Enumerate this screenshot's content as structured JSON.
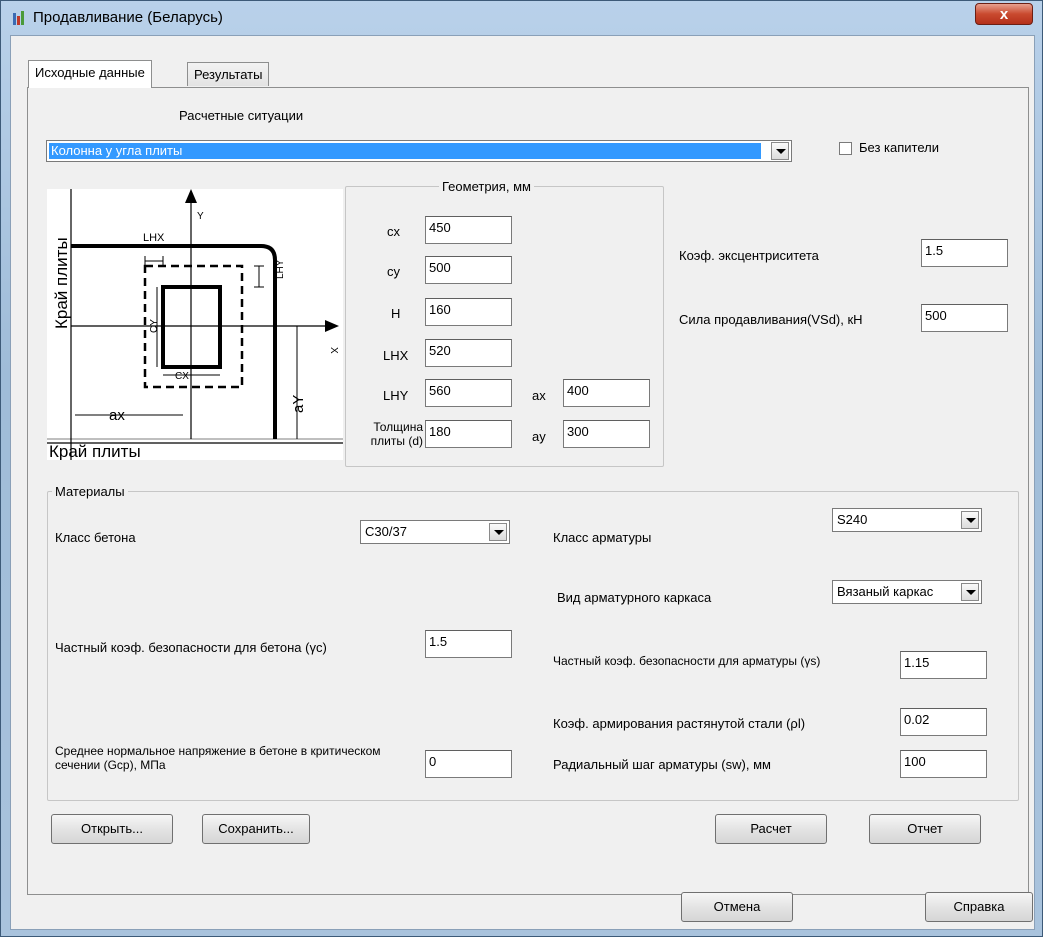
{
  "window": {
    "title": "Продавливание (Беларусь)",
    "close_label": "x"
  },
  "tabs": [
    {
      "label": "Исходные данные",
      "active": true
    },
    {
      "label": "Результаты",
      "active": false
    }
  ],
  "situations": {
    "label": "Расчетные ситуации",
    "selected": "Колонна у угла плиты"
  },
  "no_capital": {
    "label": "Без капители",
    "checked": false
  },
  "diagram": {
    "axis_y": "Y",
    "axis_x": "X",
    "lhx": "LHX",
    "lhy": "LHY",
    "cy": "CY",
    "cx": "CX",
    "ax": "ax",
    "ay": "aY",
    "edge_left": "Край плиты",
    "edge_bottom": "Край плиты"
  },
  "geometry": {
    "title": "Геометрия, мм",
    "cx": {
      "label": "cx",
      "value": "450"
    },
    "cy": {
      "label": "cy",
      "value": "500"
    },
    "h": {
      "label": "H",
      "value": "160"
    },
    "lhx": {
      "label": "LHX",
      "value": "520"
    },
    "lhy": {
      "label": "LHY",
      "value": "560"
    },
    "d": {
      "label_line1": "Толщина",
      "label_line2": "плиты (d)",
      "value": "180"
    },
    "ax": {
      "label": "ax",
      "value": "400"
    },
    "ay": {
      "label": "ay",
      "value": "300"
    }
  },
  "eccentricity": {
    "label": "Коэф. эксцентриситета",
    "value": "1.5"
  },
  "force": {
    "label": "Сила продавливания(VSd), кН",
    "value": "500"
  },
  "materials": {
    "title": "Материалы",
    "concrete_class": {
      "label": "Класс бетона",
      "value": "C30/37"
    },
    "rebar_class": {
      "label": "Класс арматуры",
      "value": "S240"
    },
    "cage_type": {
      "label": "Вид арматурного каркаса",
      "value": "Вязаный каркас"
    },
    "gamma_c": {
      "label": "Частный коэф. безопасности для бетона (γc)",
      "value": "1.5"
    },
    "gamma_s": {
      "label": "Частный коэф. безопасности для арматуры (γs)",
      "value": "1.15"
    },
    "rho_l": {
      "label": "Коэф. армирования растянутой стали (ρl)",
      "value": "0.02"
    },
    "sigma_cp": {
      "label": "Среднее нормальное напряжение в бетоне в критическом сечении (Gcp), МПа",
      "value": "0"
    },
    "sw": {
      "label": "Радиальный шаг  арматуры (sw), мм",
      "value": "100"
    }
  },
  "buttons": {
    "open": "Открыть...",
    "save": "Сохранить...",
    "calculate": "Расчет",
    "report": "Отчет",
    "cancel": "Отмена",
    "help": "Справка"
  }
}
